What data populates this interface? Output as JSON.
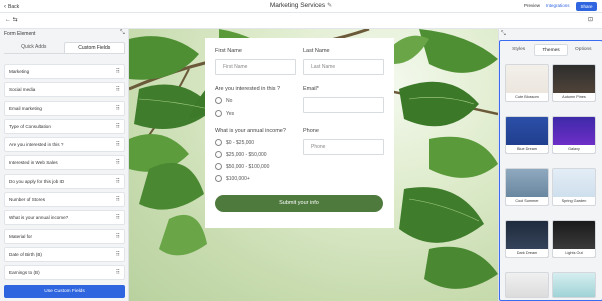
{
  "topbar": {
    "back_label": "Back",
    "title": "Marketing Services",
    "preview_label": "Preview",
    "integrations_label": "Integrations",
    "share_label": "Share"
  },
  "subbar": {
    "left_icons": "←  ⇆",
    "right_icon": "⊡"
  },
  "left_panel": {
    "title": "Form Element",
    "tabs": [
      "Quick Adds",
      "Custom Fields"
    ],
    "items": [
      "Marketing",
      "Social media",
      "Email marketing",
      "Type of Consultation",
      "Are you interested in this ?",
      "Interested in Web Sales",
      "Do you apply for this job ID",
      "Number of Stores",
      "What is your annual income?",
      "Material for",
      "Date of Birth (B)",
      "Earnings to (B)"
    ],
    "use_button": "Use Custom Fields"
  },
  "form": {
    "first_name_label": "First Name",
    "first_name_placeholder": "First Name",
    "last_name_label": "Last Name",
    "last_name_placeholder": "Last Name",
    "interest_question": "Are you interested in this ?",
    "interest_options": [
      "No",
      "Yes"
    ],
    "email_label": "Email*",
    "income_question": "What is your annual income?",
    "income_options": [
      "$0 - $25,000",
      "$25,000 - $50,000",
      "$50,000 - $100,000",
      "$100,000+"
    ],
    "phone_label": "Phone",
    "phone_placeholder": "Phone",
    "submit_label": "Submit your info"
  },
  "right_panel": {
    "tabs": [
      "Styles",
      "Themes",
      "Options"
    ],
    "thumbs": [
      "Cute Blossom",
      "Autumn Pines",
      "Blue Dream",
      "Galaxy",
      "Cool Summer",
      "Spring Garden",
      "Dark Dream",
      "Lights Out"
    ]
  },
  "colors": {
    "accent": "#2f66e0",
    "submit_green": "#4f7a3e",
    "leaf_green": "#3f7d2c"
  }
}
